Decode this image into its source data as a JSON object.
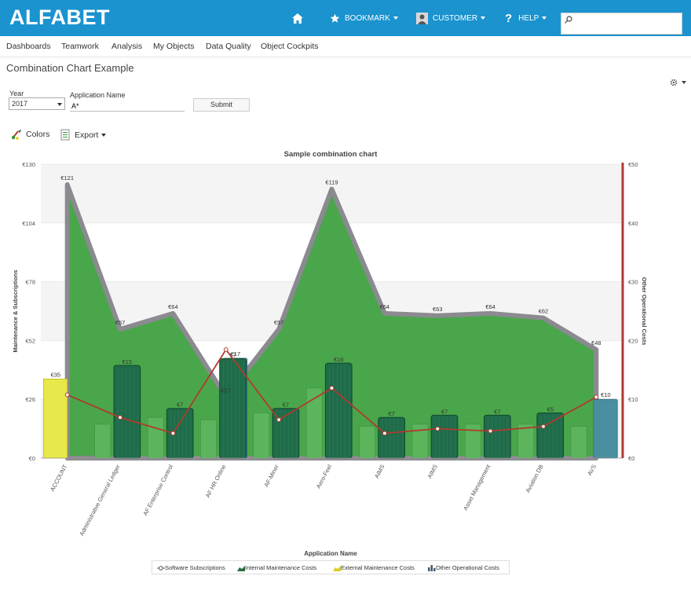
{
  "header": {
    "logo": "ALFABET",
    "bookmark": "BOOKMARK",
    "customer": "CUSTOMER",
    "help": "HELP",
    "search_placeholder": ""
  },
  "menu": [
    "Dashboards",
    "Teamwork",
    "Analysis",
    "My Objects",
    "Data Quality",
    "Object Cockpits"
  ],
  "page_title": "Combination Chart Example",
  "form": {
    "year_label": "Year",
    "year_value": "2017",
    "app_label": "Application Name",
    "app_value": "A*",
    "submit_label": "Submit"
  },
  "toolbar": {
    "colors_label": "Colors",
    "export_label": "Export"
  },
  "colors": {
    "area": "#4aa64a",
    "area_border": "#8a8a90",
    "internal": "#1f6b4a",
    "external": "#e8e84a",
    "other": "#4a8fa0",
    "line": "#b03a2e",
    "right_axis": "#b03a2e"
  },
  "chart_data": {
    "type": "combination",
    "title": "Sample combination chart",
    "xlabel": "Application Name",
    "ylabel_left": "Maintenance & Subscriptions",
    "ylabel_right": "Other Operational Costs",
    "ylim_left": [
      0,
      130
    ],
    "ylim_right": [
      0,
      50
    ],
    "left_ticks": [
      "€0",
      "€26",
      "€52",
      "€78",
      "€104",
      "€130"
    ],
    "right_ticks": [
      "€0",
      "€10",
      "€20",
      "€30",
      "€40",
      "€50"
    ],
    "categories": [
      "ACCOUNT",
      "Administrative General Ledger",
      "AF Enterprise Control",
      "AF HR Online",
      "AF-Miner",
      "Aero-Feel",
      "AIMS",
      "AIMS",
      "Asset Management",
      "Aviation DB",
      "AVS"
    ],
    "series": [
      {
        "name": "Software Subscriptions",
        "kind": "area",
        "axis": "left",
        "values": [
          121,
          57,
          64,
          27,
          57,
          119,
          64,
          63,
          64,
          62,
          48
        ],
        "labels": [
          "€121",
          "€57",
          "€64",
          "€27",
          "€57",
          "€119",
          "€64",
          "€63",
          "€64",
          "€62",
          "€48"
        ]
      },
      {
        "name": "Internal Maintenance Costs",
        "kind": "bar",
        "axis": "left",
        "values": [
          null,
          41,
          22,
          44,
          22,
          42,
          18,
          19,
          19,
          20,
          null
        ],
        "labels": [
          "",
          "€41",
          "€22",
          "€44",
          "€22",
          "€42",
          "€18",
          "€19",
          "€19",
          "€20",
          ""
        ],
        "shadow_values": [
          null,
          15,
          18,
          17,
          20,
          31,
          14,
          15,
          15,
          15,
          14
        ],
        "shadow_labels": [
          "",
          "€15",
          "€18",
          "€17",
          "€20",
          "€31",
          "€14",
          "€15",
          "€15",
          "€15",
          "€14"
        ],
        "top_labels": [
          "",
          "€15",
          "€7",
          "€7",
          "€7",
          "€16",
          "€7",
          "€7",
          "€7",
          "€5",
          ""
        ]
      },
      {
        "name": "External Maintenance Costs",
        "kind": "bar",
        "axis": "left",
        "values": [
          35,
          null,
          null,
          null,
          null,
          null,
          null,
          null,
          null,
          null,
          null
        ],
        "labels": [
          "€35",
          "",
          "",
          "",
          "",
          "",
          "",
          "",
          "",
          "",
          ""
        ]
      },
      {
        "name": "Other Operational Costs",
        "kind": "bar",
        "axis": "right",
        "values": [
          null,
          null,
          null,
          17,
          null,
          null,
          null,
          null,
          null,
          null,
          10
        ],
        "labels": [
          "",
          "",
          "",
          "€17",
          "",
          "",
          "",
          "",
          "",
          "",
          "€10"
        ]
      },
      {
        "name": "Software Subscriptions Line",
        "kind": "line",
        "axis": "left",
        "values": [
          28,
          18,
          11,
          48,
          17,
          31,
          11,
          13,
          12,
          14,
          27
        ],
        "labels": [
          "€28",
          "€18",
          "€11",
          "€48",
          "€17",
          "€31",
          "€11",
          "€13",
          "€12",
          "€14",
          "€27"
        ]
      }
    ],
    "legend": [
      "Software Subscriptions",
      "Internal Maintenance Costs",
      "External Maintenance Costs",
      "Other Operational Costs"
    ]
  }
}
